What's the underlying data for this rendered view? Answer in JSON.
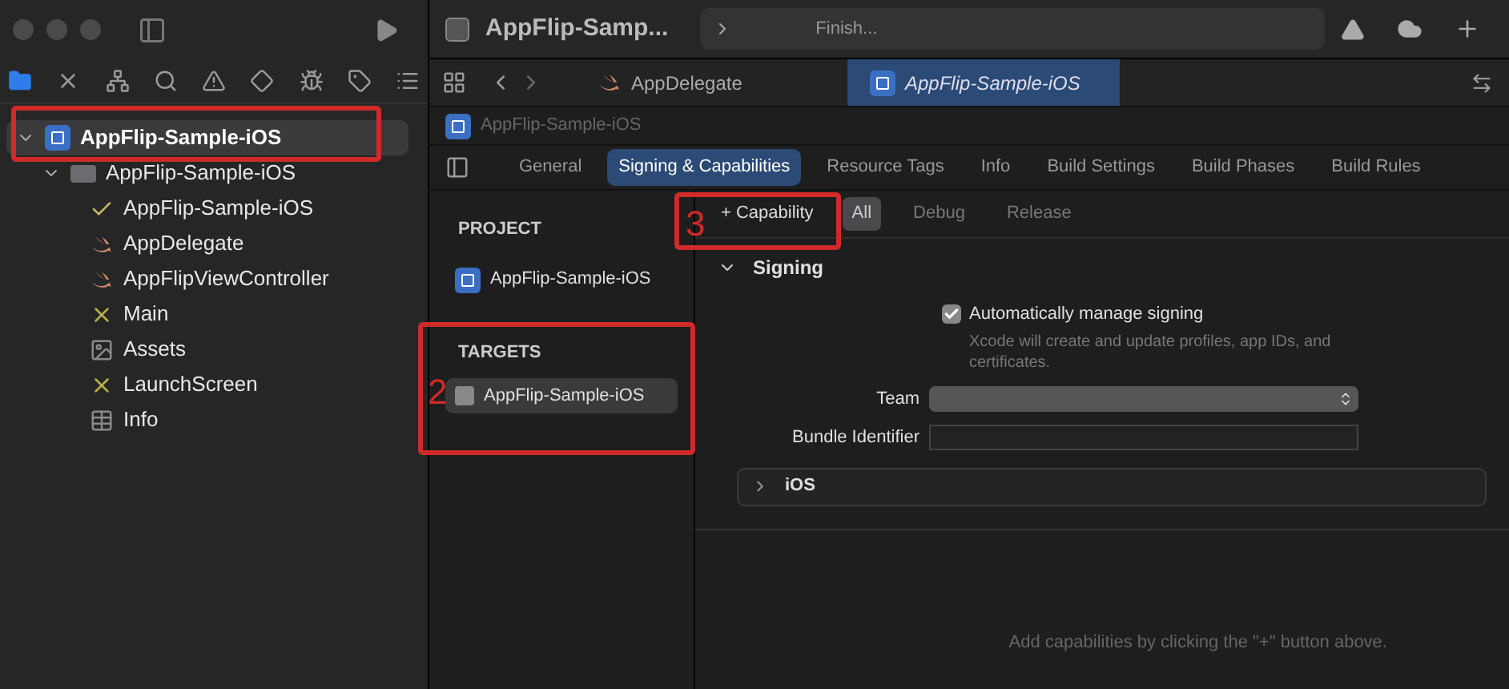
{
  "sidebar": {
    "tree": [
      {
        "label": "AppFlip-Sample-iOS",
        "kind": "project",
        "expanded": true,
        "selected": true,
        "children": [
          {
            "label": "AppFlip-Sample-iOS",
            "kind": "folder",
            "expanded": true,
            "selected": false,
            "children": [
              {
                "label": "AppFlip-Sample-iOS",
                "kind": "entitlements",
                "selected": false
              },
              {
                "label": "AppDelegate",
                "kind": "swift",
                "selected": false
              },
              {
                "label": "AppFlipViewController",
                "kind": "swift",
                "selected": false
              },
              {
                "label": "Main",
                "kind": "storyboard",
                "selected": false
              },
              {
                "label": "Assets",
                "kind": "assets",
                "selected": false
              },
              {
                "label": "LaunchScreen",
                "kind": "storyboard",
                "selected": false
              },
              {
                "label": "Info",
                "kind": "plist",
                "selected": false
              }
            ]
          }
        ]
      }
    ]
  },
  "toolbar": {
    "title": "AppFlip-Samp...",
    "status": "Finish..."
  },
  "editor_tabs": [
    {
      "label": "AppDelegate",
      "kind": "swift",
      "selected": false
    },
    {
      "label": "AppFlip-Sample-iOS",
      "kind": "project",
      "selected": true
    }
  ],
  "breadcrumb": "AppFlip-Sample-iOS",
  "settings_tabs": [
    {
      "label": "General",
      "selected": false
    },
    {
      "label": "Signing & Capabilities",
      "selected": true
    },
    {
      "label": "Resource Tags",
      "selected": false
    },
    {
      "label": "Info",
      "selected": false
    },
    {
      "label": "Build Settings",
      "selected": false
    },
    {
      "label": "Build Phases",
      "selected": false
    },
    {
      "label": "Build Rules",
      "selected": false
    }
  ],
  "project_list": {
    "project_heading": "PROJECT",
    "project": "AppFlip-Sample-iOS",
    "targets_heading": "TARGETS",
    "targets": [
      {
        "label": "AppFlip-Sample-iOS",
        "selected": true
      }
    ]
  },
  "capability_button": "+ Capability",
  "config_filters": [
    {
      "label": "All",
      "selected": true
    },
    {
      "label": "Debug",
      "selected": false
    },
    {
      "label": "Release",
      "selected": false
    }
  ],
  "signing": {
    "title": "Signing",
    "expanded": true,
    "auto_manage": {
      "label": "Automatically manage signing",
      "checked": true,
      "hint": "Xcode will create and update profiles, app IDs, and certificates."
    },
    "team_label": "Team",
    "bundle_label": "Bundle Identifier"
  },
  "ios_section": {
    "title": "iOS",
    "expanded": false
  },
  "empty_hint": "Add capabilities by clicking the \"+\" button above.",
  "annotations": [
    "2",
    "3"
  ]
}
